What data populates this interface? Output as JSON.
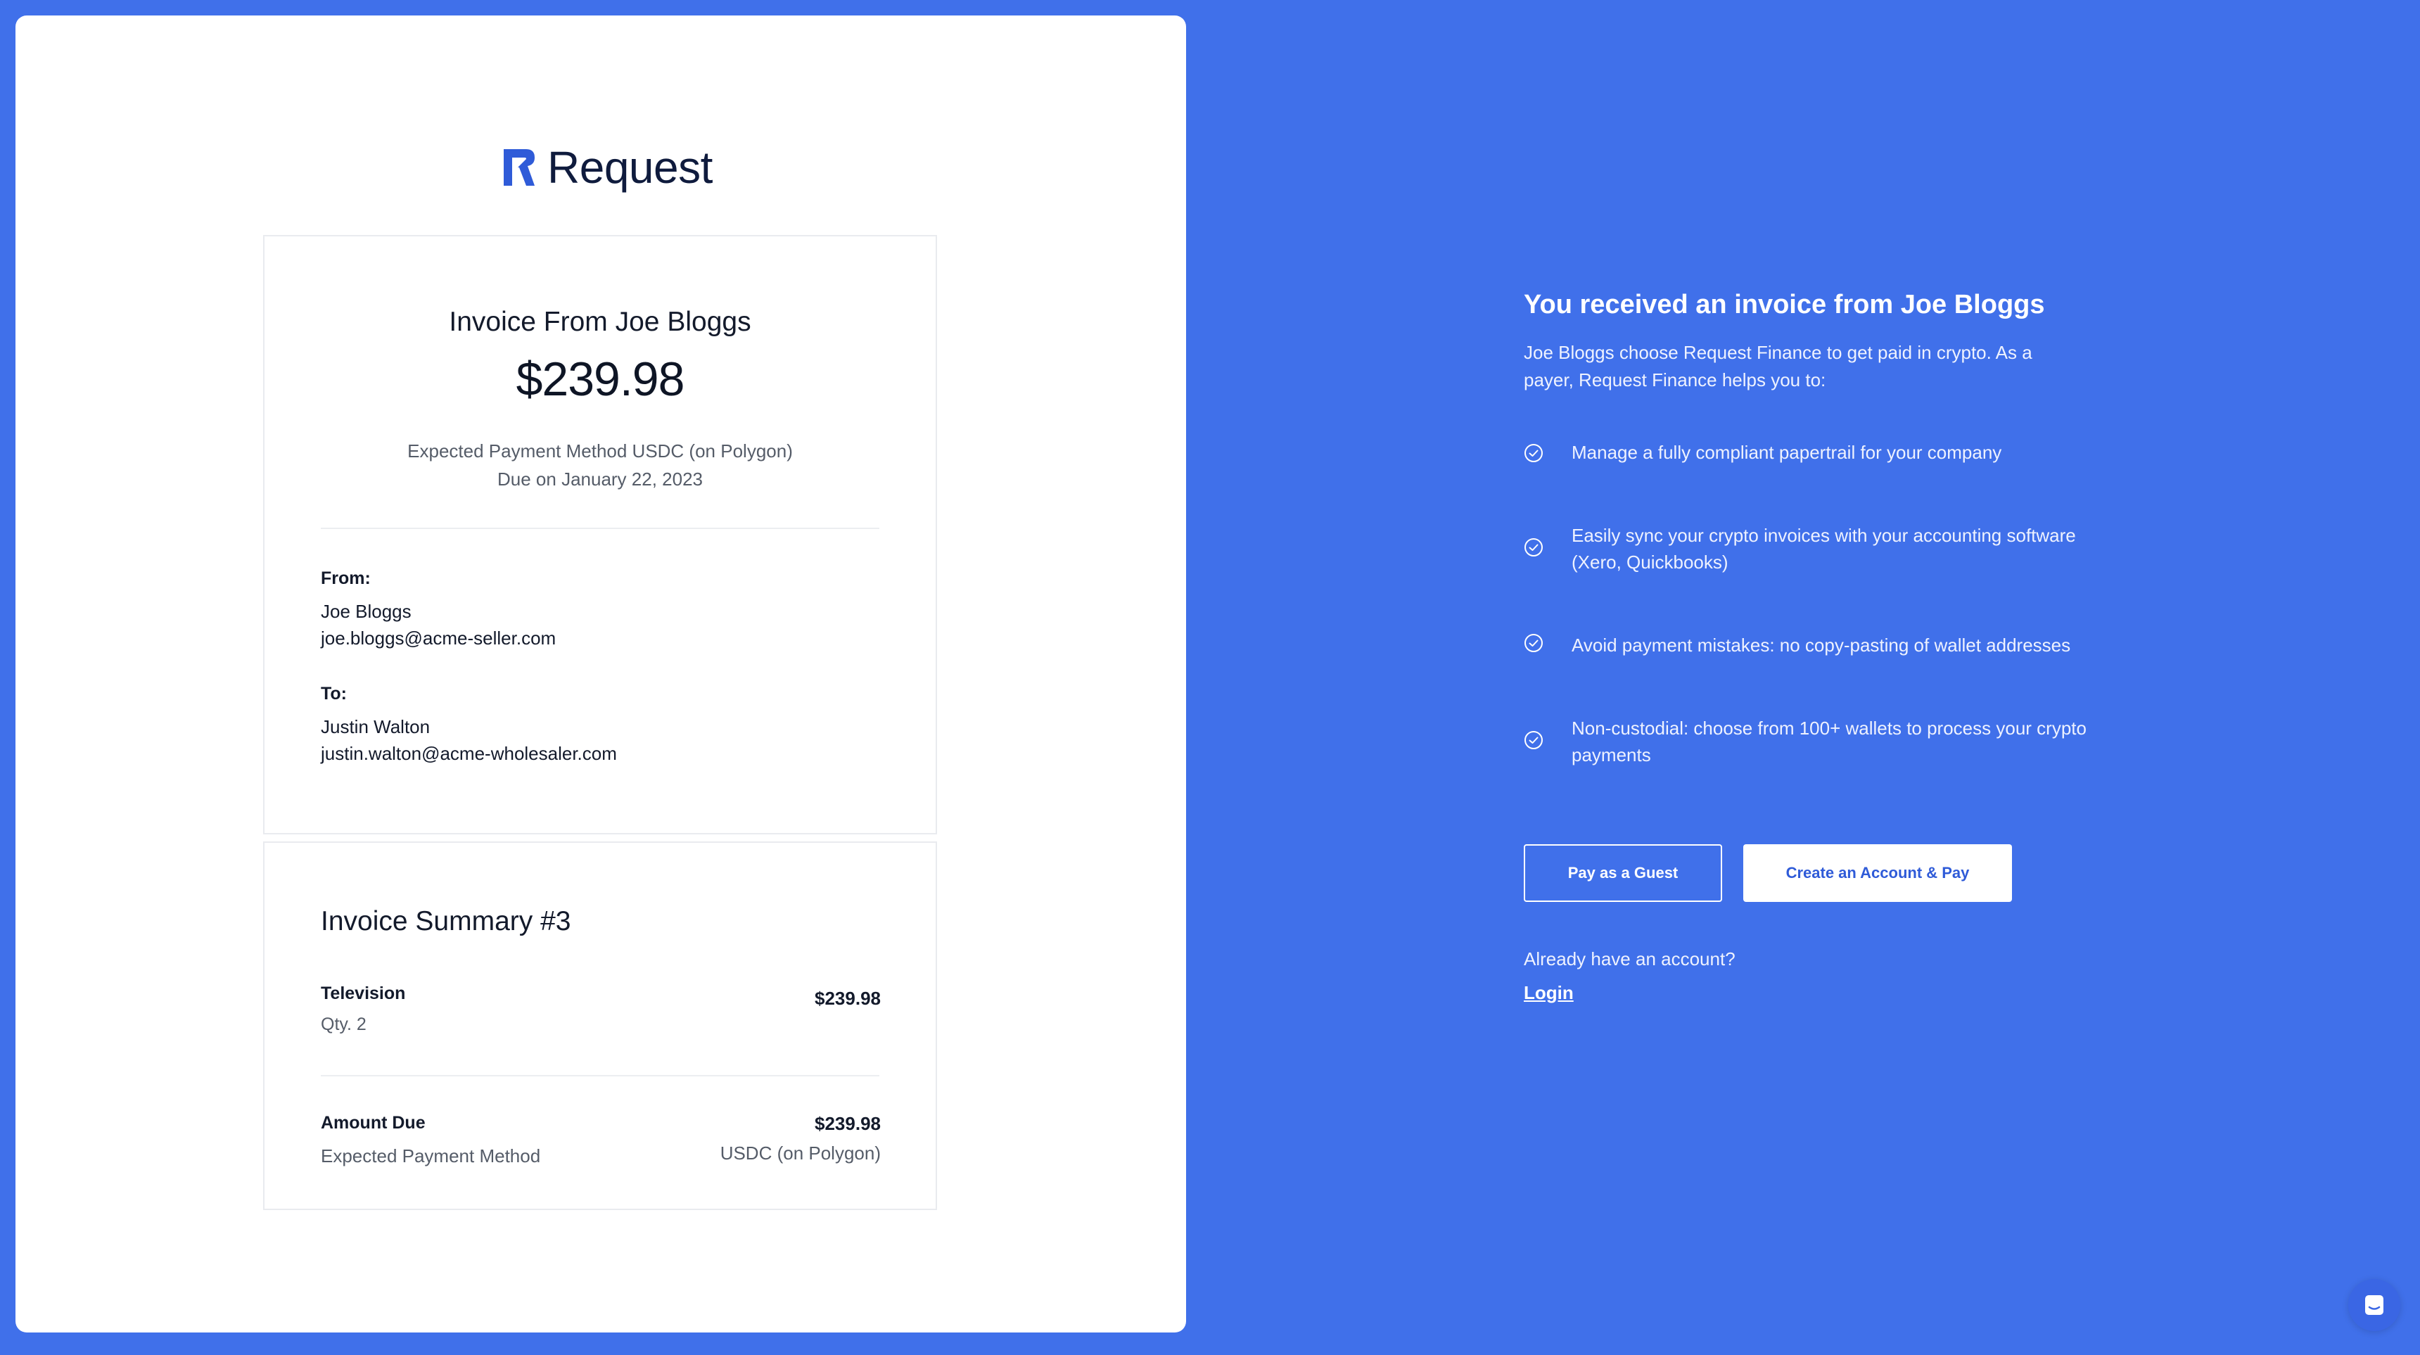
{
  "logo": {
    "text": "Request"
  },
  "invoice": {
    "title": "Invoice From Joe Bloggs",
    "amount": "$239.98",
    "expected_method": "Expected Payment Method USDC (on Polygon)",
    "due": "Due on January 22, 2023",
    "from": {
      "label": "From:",
      "name": "Joe Bloggs",
      "email": "joe.bloggs@acme-seller.com"
    },
    "to": {
      "label": "To:",
      "name": "Justin Walton",
      "email": "justin.walton@acme-wholesaler.com"
    }
  },
  "summary": {
    "title": "Invoice Summary #3",
    "items": [
      {
        "name": "Television",
        "qty": "Qty. 2",
        "price": "$239.98"
      }
    ],
    "amount_due_label": "Amount Due",
    "amount_due_method_label": "Expected Payment Method",
    "amount_due_value": "$239.98",
    "amount_due_currency": "USDC (on Polygon)"
  },
  "right": {
    "title": "You received an invoice from Joe Bloggs",
    "description": "Joe Bloggs choose Request Finance to get paid in crypto. As a payer, Request Finance helps you to:",
    "features": [
      "Manage a fully compliant papertrail for your company",
      "Easily sync your crypto invoices with your accounting software (Xero, Quickbooks)",
      "Avoid payment mistakes: no copy-pasting of wallet addresses",
      "Non-custodial: choose from 100+ wallets to process your crypto payments"
    ],
    "pay_guest_label": "Pay as a Guest",
    "create_account_label": "Create an Account & Pay",
    "already_text": "Already have an account?",
    "login_label": "Login"
  },
  "icons": {
    "logo_mark": "request-logo-icon",
    "check": "check-circle-icon",
    "chat": "chat-icon"
  },
  "colors": {
    "background_blue": "#4070ea",
    "logo_blue": "#2f5bd8",
    "text_dark": "#131a2b",
    "text_muted": "#555c68"
  }
}
